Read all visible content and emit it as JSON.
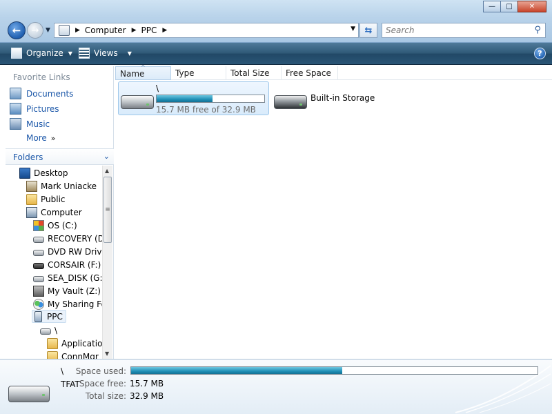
{
  "window": {
    "minimize_glyph": "—",
    "maximize_glyph": "□",
    "close_glyph": "✕"
  },
  "nav": {
    "back_glyph": "←",
    "forward_glyph": "→",
    "dropdown_glyph": "▼",
    "refresh_glyph": "⇆"
  },
  "address": {
    "segments": [
      "Computer",
      "PPC"
    ],
    "separator": "▶"
  },
  "search": {
    "placeholder": "Search"
  },
  "commandbar": {
    "organize_label": "Organize",
    "views_label": "Views",
    "help_label": "?"
  },
  "favorites": {
    "title": "Favorite Links",
    "items": [
      {
        "label": "Documents",
        "icon": "documents-icon"
      },
      {
        "label": "Pictures",
        "icon": "pictures-icon"
      },
      {
        "label": "Music",
        "icon": "music-icon"
      }
    ],
    "more_label": "More",
    "more_glyph": "»"
  },
  "folders": {
    "title": "Folders",
    "chevron": "⌄",
    "tree": [
      {
        "label": "Desktop",
        "icon": "desktop-icon",
        "level": 0
      },
      {
        "label": "Mark Uniacke",
        "icon": "user-icon",
        "level": 1
      },
      {
        "label": "Public",
        "icon": "folder-icon",
        "level": 1
      },
      {
        "label": "Computer",
        "icon": "computer-icon",
        "level": 1
      },
      {
        "label": "OS (C:)",
        "icon": "windows-drive-icon",
        "level": 2
      },
      {
        "label": "RECOVERY (D:)",
        "icon": "drive-icon",
        "level": 2
      },
      {
        "label": "DVD RW Drive",
        "icon": "dvd-drive-icon",
        "level": 2
      },
      {
        "label": "CORSAIR (F:)",
        "icon": "removable-drive-icon",
        "level": 2
      },
      {
        "label": "SEA_DISK (G:)",
        "icon": "drive-icon",
        "level": 2
      },
      {
        "label": "My Vault (Z:)",
        "icon": "vault-icon",
        "level": 2
      },
      {
        "label": "My Sharing Fo",
        "icon": "sharing-folder-icon",
        "level": 2
      },
      {
        "label": "PPC",
        "icon": "ppc-device-icon",
        "level": 2,
        "selected": true
      },
      {
        "label": "\\",
        "icon": "drive-icon",
        "level": 3
      },
      {
        "label": "Application",
        "icon": "folder-icon",
        "level": 4
      },
      {
        "label": "ConnMgr",
        "icon": "folder-icon",
        "level": 4
      }
    ]
  },
  "columns": [
    "Name",
    "Type",
    "Total Size",
    "Free Space"
  ],
  "sort_glyph": "^",
  "items": [
    {
      "name": "\\",
      "free_text": "15.7 MB free of 32.9 MB",
      "used_fraction": 0.52,
      "selected": true
    },
    {
      "name": "Built-in Storage"
    }
  ],
  "details": {
    "name": "\\",
    "filesystem": "TFAT",
    "space_used_label": "Space used:",
    "space_free_label": "Space free:",
    "space_free_value": "15.7 MB",
    "total_size_label": "Total size:",
    "total_size_value": "32.9 MB",
    "used_fraction": 0.52
  },
  "colors": {
    "commandbar": "#2a5576",
    "link": "#1a56a8",
    "progress": "#1f8fb6"
  }
}
